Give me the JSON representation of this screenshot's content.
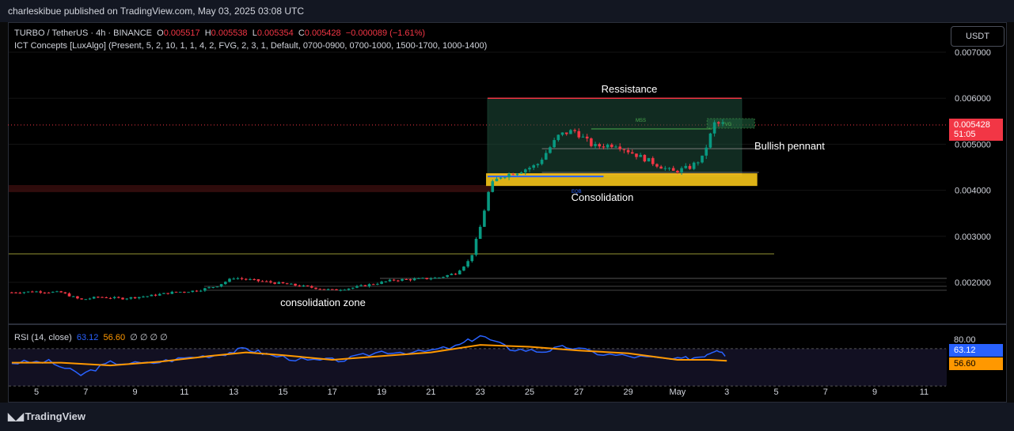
{
  "header": {
    "published": "charleskibue published on TradingView.com, May 03, 2025 03:08 UTC"
  },
  "legend": {
    "symbol": "TURBO / TetherUS · 4h · BINANCE",
    "o_label": "O",
    "o_value": "0.005517",
    "h_label": "H",
    "h_value": "0.005538",
    "l_label": "L",
    "l_value": "0.005354",
    "c_label": "C",
    "c_value": "0.005428",
    "change": "−0.000089 (−1.61%)",
    "indicator": "ICT Concepts [LuxAlgo] (Present, 5, 2, 10, 1, 1, 4, 2, FVG, 2, 3, 1, Default, 0700-0900, 0700-1000, 1500-1700, 1000-1400)"
  },
  "currency_button": "USDT",
  "last_price": {
    "value": "0.005428",
    "countdown": "51:05"
  },
  "rsi": {
    "label": "RSI (14, close)",
    "rsi_value": "63.12",
    "ma_value": "56.60",
    "extra": "∅ ∅ ∅ ∅",
    "upper_tick": "80.00"
  },
  "footer": {
    "brand": "TradingView"
  },
  "colors": {
    "up": "#089981",
    "down": "#f23645",
    "rsi": "#2962ff",
    "rsi_ma": "#ff9800",
    "zone": "#f5c518",
    "box": "#1f4f3c"
  },
  "chart_data": {
    "type": "candlestick",
    "title": "TURBO / TetherUS · 4h · BINANCE",
    "y_ticks": [
      "0.007000",
      "0.006000",
      "0.005000",
      "0.004000",
      "0.003000",
      "0.002000"
    ],
    "x_ticks": [
      "5",
      "7",
      "9",
      "11",
      "13",
      "15",
      "17",
      "19",
      "21",
      "23",
      "25",
      "27",
      "29",
      "May",
      "3",
      "5",
      "7",
      "9",
      "11"
    ],
    "annotations": [
      "Ressistance",
      "Bullish pennant",
      "Consolidation",
      "consolidation zone"
    ],
    "box_labels": [
      "MSS",
      "FVG",
      "EQB"
    ],
    "price_path": [
      {
        "day": 4.0,
        "close": 0.00178
      },
      {
        "day": 5.0,
        "close": 0.0018
      },
      {
        "day": 6.0,
        "close": 0.00178
      },
      {
        "day": 6.8,
        "close": 0.00162
      },
      {
        "day": 7.5,
        "close": 0.00168
      },
      {
        "day": 8.5,
        "close": 0.00165
      },
      {
        "day": 9.5,
        "close": 0.0017
      },
      {
        "day": 10.5,
        "close": 0.00178
      },
      {
        "day": 11.5,
        "close": 0.00182
      },
      {
        "day": 12.3,
        "close": 0.00192
      },
      {
        "day": 13.0,
        "close": 0.0021
      },
      {
        "day": 14.0,
        "close": 0.00203
      },
      {
        "day": 15.0,
        "close": 0.00197
      },
      {
        "day": 16.0,
        "close": 0.0019
      },
      {
        "day": 17.0,
        "close": 0.00183
      },
      {
        "day": 17.8,
        "close": 0.00188
      },
      {
        "day": 18.5,
        "close": 0.00195
      },
      {
        "day": 19.5,
        "close": 0.00205
      },
      {
        "day": 20.5,
        "close": 0.00207
      },
      {
        "day": 21.3,
        "close": 0.0021
      },
      {
        "day": 22.0,
        "close": 0.0022
      },
      {
        "day": 22.6,
        "close": 0.0025
      },
      {
        "day": 23.0,
        "close": 0.0032
      },
      {
        "day": 23.4,
        "close": 0.0041
      },
      {
        "day": 23.8,
        "close": 0.0043
      },
      {
        "day": 24.5,
        "close": 0.0044
      },
      {
        "day": 25.3,
        "close": 0.00455
      },
      {
        "day": 26.2,
        "close": 0.0052
      },
      {
        "day": 26.8,
        "close": 0.0053
      },
      {
        "day": 27.6,
        "close": 0.00495
      },
      {
        "day": 28.5,
        "close": 0.005
      },
      {
        "day": 29.2,
        "close": 0.0048
      },
      {
        "day": 30.0,
        "close": 0.0046
      },
      {
        "day": 30.8,
        "close": 0.0044
      },
      {
        "day": 31.5,
        "close": 0.0045
      },
      {
        "day": 32.0,
        "close": 0.0047
      },
      {
        "day": 32.5,
        "close": 0.00545
      },
      {
        "day": 33.0,
        "close": 0.00543
      }
    ],
    "resistance_level": 0.006,
    "support_level": 0.0043,
    "rsi_series": [
      {
        "day": 4.0,
        "rsi": 55
      },
      {
        "day": 5.5,
        "rsi": 56
      },
      {
        "day": 6.8,
        "rsi": 42
      },
      {
        "day": 8.0,
        "rsi": 55
      },
      {
        "day": 9.5,
        "rsi": 54
      },
      {
        "day": 11.0,
        "rsi": 60
      },
      {
        "day": 12.5,
        "rsi": 64
      },
      {
        "day": 13.5,
        "rsi": 70
      },
      {
        "day": 14.5,
        "rsi": 63
      },
      {
        "day": 16.0,
        "rsi": 57
      },
      {
        "day": 17.5,
        "rsi": 58
      },
      {
        "day": 19.0,
        "rsi": 67
      },
      {
        "day": 20.5,
        "rsi": 66
      },
      {
        "day": 22.0,
        "rsi": 72
      },
      {
        "day": 23.0,
        "rsi": 84
      },
      {
        "day": 24.2,
        "rsi": 70
      },
      {
        "day": 25.5,
        "rsi": 67
      },
      {
        "day": 26.5,
        "rsi": 72
      },
      {
        "day": 28.0,
        "rsi": 64
      },
      {
        "day": 29.5,
        "rsi": 61
      },
      {
        "day": 31.0,
        "rsi": 58
      },
      {
        "day": 32.0,
        "rsi": 62
      },
      {
        "day": 32.6,
        "rsi": 70
      },
      {
        "day": 33.0,
        "rsi": 63
      }
    ],
    "rsi_ma_series": [
      {
        "day": 4.0,
        "v": 55
      },
      {
        "day": 6.0,
        "v": 55
      },
      {
        "day": 8.0,
        "v": 52
      },
      {
        "day": 10.0,
        "v": 56
      },
      {
        "day": 12.0,
        "v": 62
      },
      {
        "day": 13.5,
        "v": 66
      },
      {
        "day": 15.0,
        "v": 63
      },
      {
        "day": 17.0,
        "v": 58
      },
      {
        "day": 19.0,
        "v": 62
      },
      {
        "day": 21.0,
        "v": 66
      },
      {
        "day": 23.0,
        "v": 74
      },
      {
        "day": 25.0,
        "v": 72
      },
      {
        "day": 27.0,
        "v": 68
      },
      {
        "day": 29.0,
        "v": 65
      },
      {
        "day": 31.0,
        "v": 58
      },
      {
        "day": 32.3,
        "v": 58
      },
      {
        "day": 33.0,
        "v": 57
      }
    ]
  }
}
